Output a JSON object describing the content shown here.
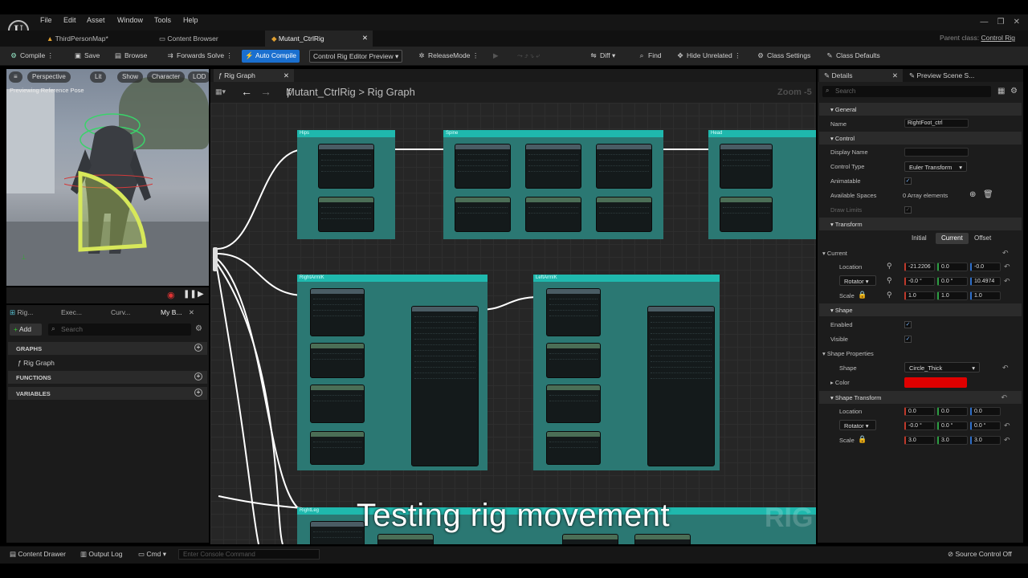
{
  "menu": [
    "File",
    "Edit",
    "Asset",
    "Window",
    "Tools",
    "Help"
  ],
  "doc_tabs": [
    "ThirdPersonMap*",
    "Content Browser",
    "Mutant_CtrlRig"
  ],
  "parent_class": {
    "label": "Parent class:",
    "value": "Control Rig"
  },
  "toolbar": {
    "compile": "Compile",
    "save": "Save",
    "browse": "Browse",
    "forwards_solve": "Forwards Solve",
    "auto_compile": "Auto Compile",
    "preview_mode": "Control Rig Editor Preview",
    "release_mode": "ReleaseMode",
    "diff": "Diff",
    "find": "Find",
    "hide_unrelated": "Hide Unrelated",
    "class_settings": "Class Settings",
    "class_defaults": "Class Defaults"
  },
  "viewport": {
    "chips": [
      "Perspective",
      "Lit",
      "Show",
      "Character",
      "LOD"
    ],
    "status": "Previewing Reference Pose"
  },
  "left_panel": {
    "tabs": [
      "Rig...",
      "Exec...",
      "Curv...",
      "My B..."
    ],
    "add": "Add",
    "search_placeholder": "Search",
    "sections": {
      "graphs": "GRAPHS",
      "functions": "FUNCTIONS",
      "variables": "VARIABLES"
    },
    "graph_item": "Rig Graph"
  },
  "graph": {
    "tab": "Rig Graph",
    "breadcrumb_root": "Mutant_CtrlRig",
    "breadcrumb_sep": ">",
    "breadcrumb_leaf": "Rig Graph",
    "zoom": "Zoom -5",
    "comments": [
      "Hips",
      "Spine",
      "Head",
      "RightArmIK",
      "LeftArmIK",
      "RightLeg"
    ],
    "watermark": "RIG"
  },
  "subtitle": "Testing rig movement",
  "details": {
    "tabs": [
      "Details",
      "Preview Scene S..."
    ],
    "search_placeholder": "Search",
    "general": {
      "header": "General",
      "name_label": "Name",
      "name_value": "RightFoot_ctrl"
    },
    "control": {
      "header": "Control",
      "display_name_label": "Display Name",
      "display_name_value": "",
      "control_type_label": "Control Type",
      "control_type_value": "Euler Transform",
      "animatable_label": "Animatable",
      "available_spaces_label": "Available Spaces",
      "available_spaces_value": "0 Array elements",
      "draw_limits_label": "Draw Limits"
    },
    "transform": {
      "header": "Transform",
      "modes": [
        "Initial",
        "Current",
        "Offset"
      ],
      "current_label": "Current",
      "location_label": "Location",
      "location": [
        "-21.2206",
        "0.0",
        "-0.0"
      ],
      "rotator_label": "Rotator",
      "rotator": [
        "-0.0 °",
        "0.0 °",
        "10.4974"
      ],
      "scale_label": "Scale",
      "scale": [
        "1.0",
        "1.0",
        "1.0"
      ]
    },
    "shape": {
      "header": "Shape",
      "enabled_label": "Enabled",
      "visible_label": "Visible",
      "props_header": "Shape Properties",
      "shape_label": "Shape",
      "shape_value": "Circle_Thick",
      "color_label": "Color",
      "color": "#e00000"
    },
    "shape_transform": {
      "header": "Shape Transform",
      "location_label": "Location",
      "location": [
        "0.0",
        "0.0",
        "0.0"
      ],
      "rotator_label": "Rotator",
      "rotator": [
        "-0.0 °",
        "0.0 °",
        "0.0 °"
      ],
      "scale_label": "Scale",
      "scale": [
        "3.0",
        "3.0",
        "3.0"
      ]
    }
  },
  "status": {
    "content_drawer": "Content Drawer",
    "output_log": "Output Log",
    "cmd": "Cmd",
    "console_placeholder": "Enter Console Command",
    "source_control": "Source Control Off"
  },
  "colors": {
    "accent_teal": "#1fb8ad",
    "button_blue": "#1a6fcf",
    "shape_color": "#e00000"
  }
}
